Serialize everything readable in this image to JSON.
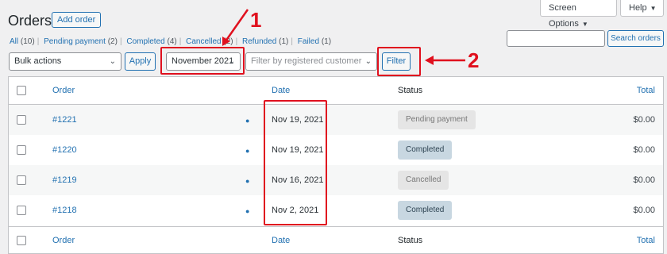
{
  "header": {
    "title": "Orders",
    "add_order": "Add order",
    "screen_options": "Screen Options",
    "help": "Help"
  },
  "filters": {
    "all": "All",
    "all_count": "(10)",
    "pending": "Pending payment",
    "pending_count": "(2)",
    "completed": "Completed",
    "completed_count": "(4)",
    "cancelled": "Cancelled",
    "cancelled_count": "(2)",
    "refunded": "Refunded",
    "refunded_count": "(1)",
    "failed": "Failed",
    "failed_count": "(1)"
  },
  "search": {
    "value": "",
    "button": "Search orders"
  },
  "toolbar": {
    "bulk_actions": "Bulk actions",
    "apply": "Apply",
    "month": "November 2021",
    "customer_placeholder": "Filter by registered customer",
    "filter": "Filter"
  },
  "annotations": {
    "marker_1": "1",
    "marker_2": "2"
  },
  "table": {
    "headers": {
      "order": "Order",
      "date": "Date",
      "status": "Status",
      "total": "Total"
    },
    "rows": [
      {
        "order": "#1221",
        "date": "Nov 19, 2021",
        "status": "Pending payment",
        "total": "$0.00"
      },
      {
        "order": "#1220",
        "date": "Nov 19, 2021",
        "status": "Completed",
        "total": "$0.00"
      },
      {
        "order": "#1219",
        "date": "Nov 16, 2021",
        "status": "Cancelled",
        "total": "$0.00"
      },
      {
        "order": "#1218",
        "date": "Nov 2, 2021",
        "status": "Completed",
        "total": "$0.00"
      }
    ]
  },
  "colors": {
    "accent": "#2271b1",
    "highlight": "#e0101e"
  }
}
